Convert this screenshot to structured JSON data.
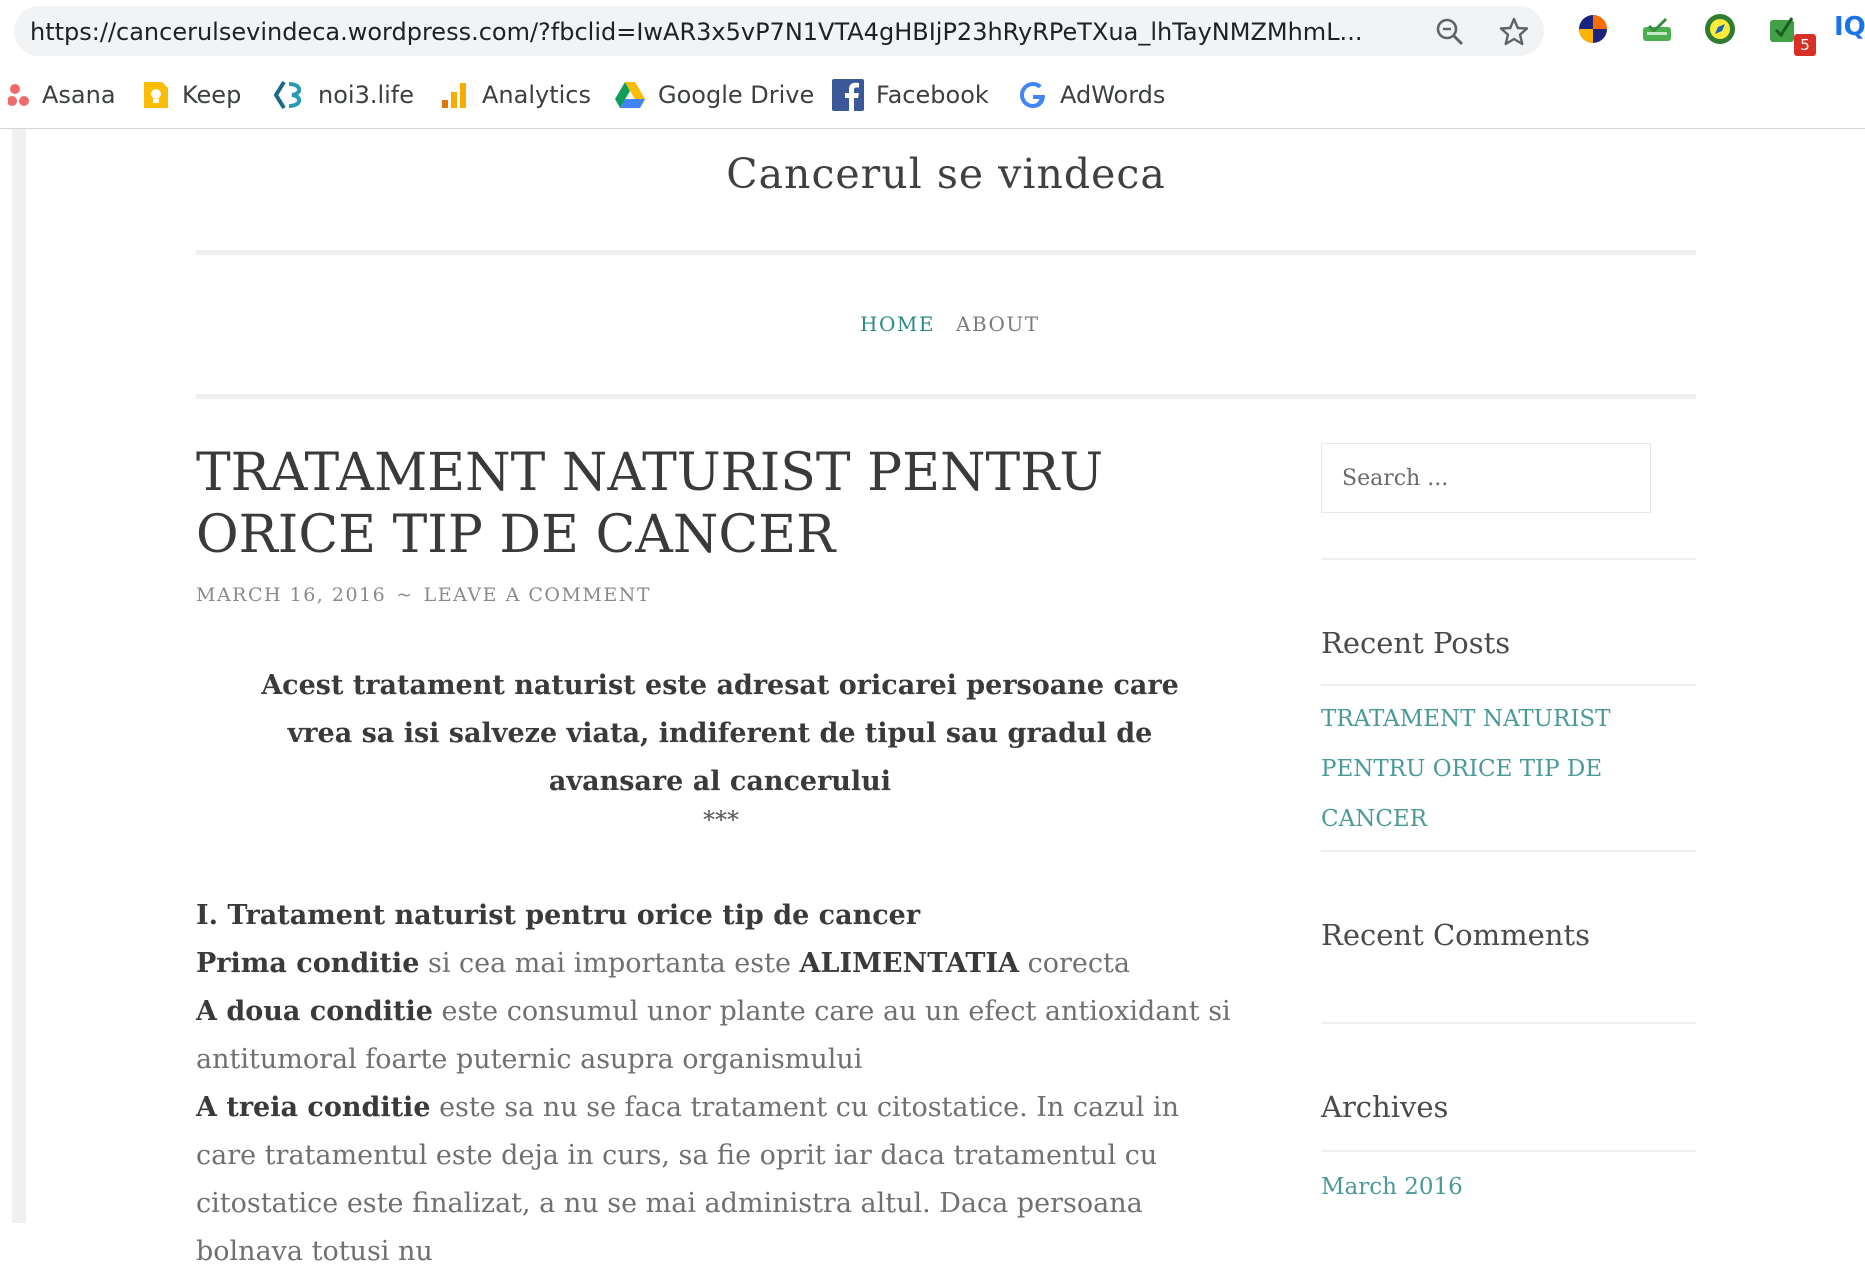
{
  "browser": {
    "url": "https://cancerulsevindeca.wordpress.com/?fbclid=IwAR3x5vP7N1VTA4gHBIjP23hRyRPeTXua_lhTayNMZMhmL...",
    "extension_badge": "5",
    "extension_text": "IQ",
    "bookmarks": [
      {
        "label": "Asana",
        "icon": "asana-icon"
      },
      {
        "label": "Keep",
        "icon": "keep-icon"
      },
      {
        "label": "noi3.life",
        "icon": "noi3-icon"
      },
      {
        "label": "Analytics",
        "icon": "analytics-icon"
      },
      {
        "label": "Google Drive",
        "icon": "google-drive-icon"
      },
      {
        "label": "Facebook",
        "icon": "facebook-icon"
      },
      {
        "label": "AdWords",
        "icon": "google-icon"
      }
    ]
  },
  "site": {
    "title": "Cancerul se vindeca",
    "nav": [
      {
        "label": "HOME",
        "active": true
      },
      {
        "label": "ABOUT",
        "active": false
      }
    ]
  },
  "post": {
    "title": "TRATAMENT NATURIST PENTRU ORICE TIP DE CANCER",
    "date": "MARCH 16, 2016",
    "separator": "~",
    "comment_link": "LEAVE A COMMENT",
    "lead": "Acest tratament naturist este adresat oricarei persoane care vrea sa isi salveze viata, indiferent de tipul sau gradul de avansare al cancerului",
    "divider": "***",
    "section_heading": "I. Tratament naturist pentru orice tip de cancer",
    "p1_bold": "Prima conditie",
    "p1_text_a": " si cea mai importanta este ",
    "p1_bold2": "ALIMENTATIA",
    "p1_text_b": " corecta",
    "p2_bold": "A doua conditie",
    "p2_text": " este consumul unor plante care au un efect antioxidant si antitumoral foarte puternic asupra organismului",
    "p3_bold": "A treia conditie",
    "p3_text": " este sa nu se faca tratament cu citostatice. In cazul in care tratamentul este deja in curs, sa fie oprit iar daca tratamentul cu citostatice este finalizat, a nu se mai administra altul. Daca persoana bolnava totusi nu"
  },
  "sidebar": {
    "search_placeholder": "Search ...",
    "recent_posts_title": "Recent Posts",
    "recent_posts": [
      "TRATAMENT NATURIST PENTRU ORICE TIP DE CANCER"
    ],
    "recent_comments_title": "Recent Comments",
    "archives_title": "Archives",
    "archives": [
      "March 2016"
    ]
  },
  "colors": {
    "accent_teal": "#2b8a8a",
    "link_teal": "#4a9a9a",
    "heading": "#3a3a3a",
    "body_text": "#707070"
  }
}
